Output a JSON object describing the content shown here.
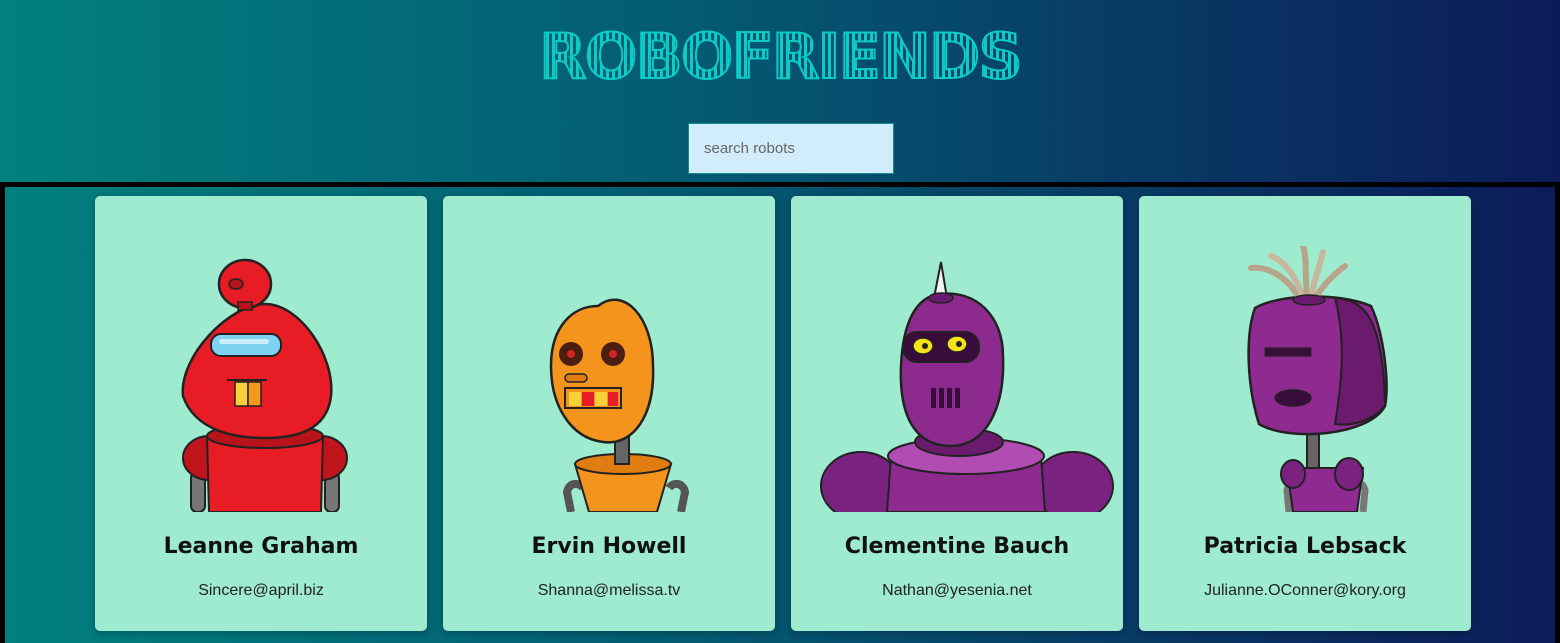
{
  "header": {
    "title": "ROBOFRIENDS",
    "search_placeholder": "search robots"
  },
  "robots": [
    {
      "name": "Leanne Graham",
      "email": "Sincere@april.biz",
      "color": "#e81c24"
    },
    {
      "name": "Ervin Howell",
      "email": "Shanna@melissa.tv",
      "color": "#f4941c"
    },
    {
      "name": "Clementine Bauch",
      "email": "Nathan@yesenia.net",
      "color": "#8d2a8e"
    },
    {
      "name": "Patricia Lebsack",
      "email": "Julianne.OConner@kory.org",
      "color": "#8e2a90"
    }
  ],
  "colors": {
    "card_bg": "#9eebcf",
    "search_bg": "#d1edfc",
    "title": "#0ccac4"
  }
}
